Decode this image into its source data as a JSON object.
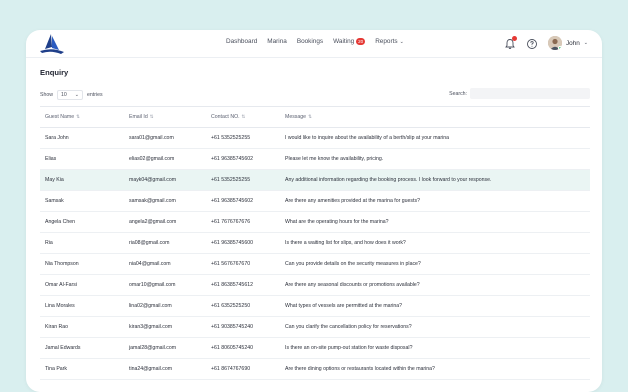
{
  "nav": {
    "items": [
      {
        "label": "Dashboard"
      },
      {
        "label": "Marina"
      },
      {
        "label": "Bookings"
      },
      {
        "label": "Waiting",
        "badge": "20"
      },
      {
        "label": "Reports"
      }
    ]
  },
  "header": {
    "user_name": "John",
    "notification_count": "1"
  },
  "page": {
    "title": "Enquiry",
    "show_label": "Show",
    "entries_value": "10",
    "entries_label": "entries",
    "search_label": "Search:",
    "search_value": ""
  },
  "table": {
    "columns": [
      "Guest Name",
      "Email Id",
      "Contact NO.",
      "Message"
    ],
    "rows": [
      {
        "name": "Sara John",
        "email": "sara01@gmail.com",
        "contact": "+61 5352525255",
        "message": "I would like to inquire about the availability of a berth/slip at your marina"
      },
      {
        "name": "Elias",
        "email": "elias02@gmail.com",
        "contact": "+61 96385745602",
        "message": "Please let me know the availability, pricing."
      },
      {
        "name": "May Kia",
        "email": "mayk04@gmail.com",
        "contact": "+61 5352525255",
        "message": "Any additional information regarding the booking process. I look forward to your response."
      },
      {
        "name": "Samsak",
        "email": "samsak@gmail.com",
        "contact": "+61 96385745602",
        "message": "Are there any amenities provided at the marina for guests?"
      },
      {
        "name": "Angela Chen",
        "email": "angela2@gmail.com",
        "contact": "+61 7676767676",
        "message": "What are the operating hours for the marina?"
      },
      {
        "name": "Ria",
        "email": "ria08@gmail.com",
        "contact": "+61 96385745600",
        "message": "Is there a waiting list for slips, and how does it work?"
      },
      {
        "name": "Nia Thompson",
        "email": "nia04@gmail.com",
        "contact": "+61 5676767670",
        "message": "Can you provide details on the security measures in place?"
      },
      {
        "name": "Omar Al-Farsi",
        "email": "omar10@gmail.com",
        "contact": "+61 86385745612",
        "message": "Are there any seasonal discounts or promotions available?"
      },
      {
        "name": "Lina Morales",
        "email": "lina02@gmail.com",
        "contact": "+61 6352525250",
        "message": "What types of vessels are permitted at the marina?"
      },
      {
        "name": "Kiran Rao",
        "email": "kiran3@gmail.com",
        "contact": "+61 90385745240",
        "message": "Can you clarify the cancellation policy for reservations?"
      },
      {
        "name": "Jamal Edwards",
        "email": "jamal28@gmail.com",
        "contact": "+61 80605745240",
        "message": "Is there an on-site pump-out station for waste disposal?"
      },
      {
        "name": "Tina Park",
        "email": "tina24@gmail.com",
        "contact": "+61 8674767690",
        "message": "Are there dining options or restaurants located within the marina?"
      }
    ]
  },
  "colors": {
    "background": "#d9efef",
    "brand": "#1f3f8a",
    "highlight_row": "#eaf5f3",
    "badge": "#e53935"
  },
  "icons": [
    "sailboat-logo-icon",
    "bell-icon",
    "help-icon",
    "chevron-down-icon",
    "sort-icon"
  ]
}
